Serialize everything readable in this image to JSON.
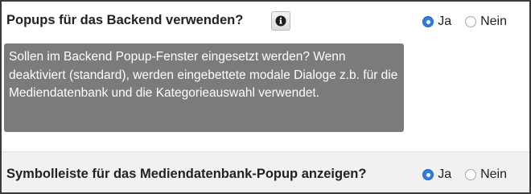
{
  "settings": [
    {
      "label": "Popups für das Backend verwenden?",
      "info_icon": "info-icon",
      "tooltip": "Sollen im Backend Popup-Fenster eingesetzt werden? Wenn deaktiviert (standard), werden eingebettete modale Dialoge z.b. für die Mediendatenbank und die Kategorieauswahl verwendet.",
      "options": [
        {
          "label": "Ja",
          "selected": true
        },
        {
          "label": "Nein",
          "selected": false
        }
      ]
    },
    {
      "label": "Symbolleiste für das Mediendatenbank-Popup anzeigen?",
      "options": [
        {
          "label": "Ja",
          "selected": true
        },
        {
          "label": "Nein",
          "selected": false
        }
      ]
    }
  ],
  "colors": {
    "radio_selected": "#2f7fe0",
    "tooltip_background": "#7b7b7b",
    "row_alt_background": "#f1f1f1"
  }
}
